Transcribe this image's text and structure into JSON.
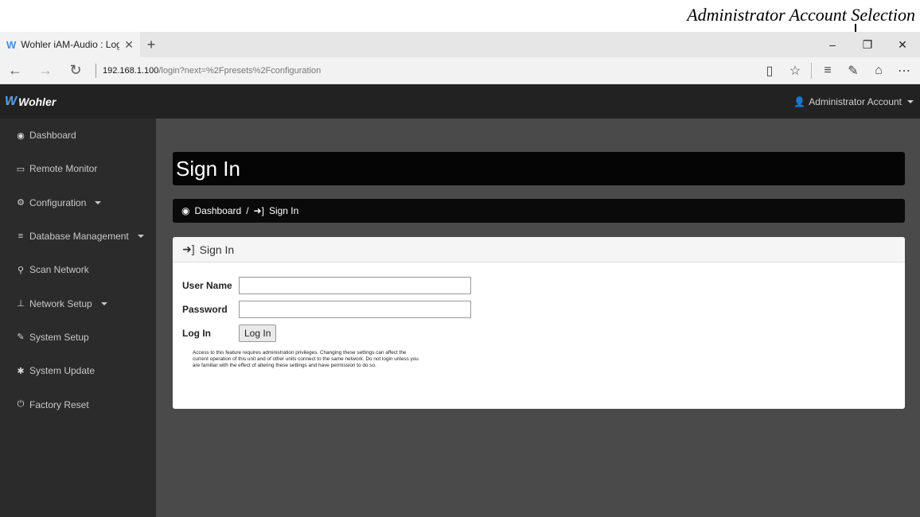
{
  "annotation": {
    "label": "Administrator Account Selection",
    "highlight_color": "#d21f1f"
  },
  "browser": {
    "tab_title": "Wohler iAM-Audio : Log",
    "tab_close": "✕",
    "new_tab": "+",
    "url_host": "192.168.1.100",
    "url_path": "/login?next=%2Fpresets%2Fconfiguration",
    "window_controls": [
      "–",
      "❐",
      "✕"
    ],
    "nav_icons": [
      "back-icon",
      "forward-icon",
      "refresh-icon"
    ],
    "tool_icons": [
      "reading-view-icon",
      "favorite-star-icon",
      "hub-icon",
      "web-note-icon",
      "share-icon",
      "more-icon"
    ]
  },
  "topnav": {
    "brand": "Wohler",
    "account_label": "Administrator Account"
  },
  "sidebar": {
    "items": [
      {
        "label": "Dashboard",
        "icon": "tachometer-icon",
        "glyph": "◉",
        "dropdown": false
      },
      {
        "label": "Remote Monitor",
        "icon": "monitor-icon",
        "glyph": "▭",
        "dropdown": false
      },
      {
        "label": "Configuration",
        "icon": "cogs-icon",
        "glyph": "⚙",
        "dropdown": true
      },
      {
        "label": "Database Management",
        "icon": "database-icon",
        "glyph": "≡",
        "dropdown": true
      },
      {
        "label": "Scan Network",
        "icon": "search-icon",
        "glyph": "⚲",
        "dropdown": false
      },
      {
        "label": "Network Setup",
        "icon": "sitemap-icon",
        "glyph": "⊥",
        "dropdown": true
      },
      {
        "label": "System Setup",
        "icon": "wrench-icon",
        "glyph": "✎",
        "dropdown": false
      },
      {
        "label": "System Update",
        "icon": "gear-icon",
        "glyph": "✱",
        "dropdown": false
      },
      {
        "label": "Factory Reset",
        "icon": "power-icon",
        "glyph": "⏻",
        "dropdown": false
      }
    ]
  },
  "main": {
    "page_title": "Sign In",
    "breadcrumb": {
      "home": "Dashboard",
      "separator": "/",
      "current": "Sign In"
    },
    "panel": {
      "title": "Sign In",
      "username_label": "User Name",
      "username_value": "",
      "password_label": "Password",
      "password_value": "",
      "login_label": "Log In",
      "login_button": "Log In",
      "notice": "Access to this feature requires administration privileges. Changing these settings can affect the current operation of this unit and of other units connect to the same network. Do not login unless you are familiar with the effect of altering these settings and have permission to do so."
    }
  }
}
